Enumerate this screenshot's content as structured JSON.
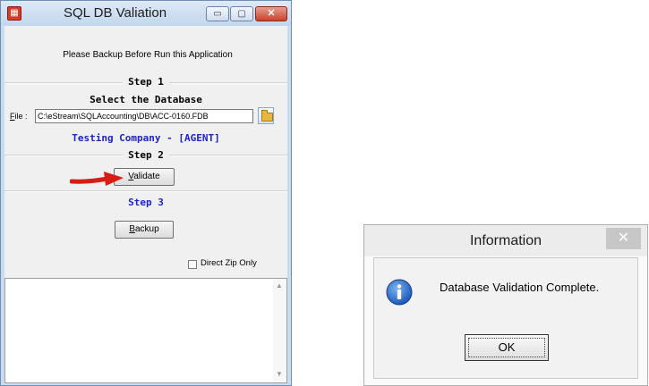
{
  "main_window": {
    "title": "SQL DB Valiation",
    "title_buttons": {
      "minimize": "▭",
      "maximize": "▢",
      "close": "✕"
    },
    "notice": "Please Backup Before Run this Application",
    "step1": {
      "header": "Step 1",
      "title": "Select the Database",
      "file_label_accel": "F",
      "file_label_rest": "ile :",
      "file_value": "C:\\eStream\\SQLAccounting\\DB\\ACC-0160.FDB",
      "company": "Testing Company - [AGENT]"
    },
    "step2": {
      "header": "Step 2",
      "validate_accel": "V",
      "validate_rest": "alidate"
    },
    "step3": {
      "header": "Step 3",
      "backup_accel": "B",
      "backup_rest": "ackup"
    },
    "direct_zip_label": "Direct Zip Only",
    "direct_zip_checked": false,
    "colors": {
      "step_blue": "#1f23c8",
      "arrow_red": "#d81e14"
    }
  },
  "info_dialog": {
    "title": "Information",
    "close_glyph": "✕",
    "message": "Database Validation Complete.",
    "ok_label": "OK",
    "icon": "info-icon"
  }
}
